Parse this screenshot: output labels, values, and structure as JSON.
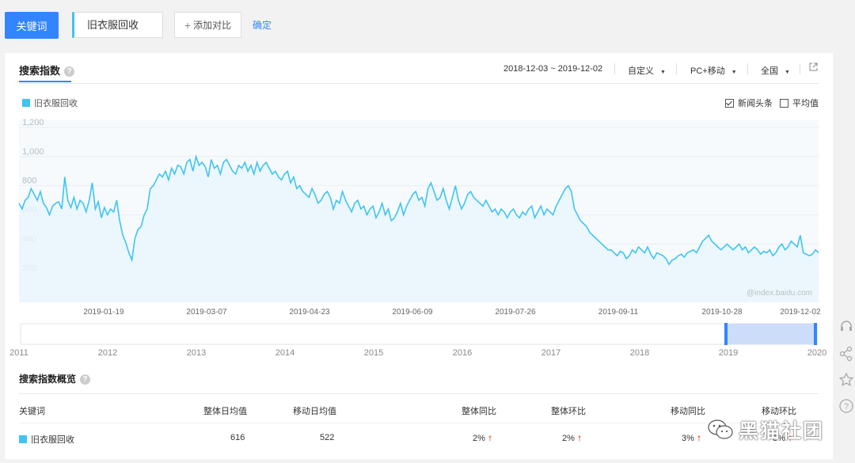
{
  "topbar": {
    "keyword_button": "关键词",
    "keyword_value": "旧衣服回收",
    "add_compare": "添加对比",
    "confirm": "确定"
  },
  "panel": {
    "tab_label": "搜索指数",
    "date_range": "2018-12-03 ~ 2019-12-02",
    "custom_select": "自定义",
    "device_select": "PC+移动",
    "region_select": "全国",
    "legend_label": "旧衣服回收",
    "checkbox_news": "新闻头条",
    "checkbox_news_checked": true,
    "checkbox_avg": "平均值",
    "checkbox_avg_checked": false,
    "watermark": "@index.baidu.com"
  },
  "chart_data": {
    "type": "area",
    "series": [
      {
        "name": "旧衣服回收",
        "color": "#3ec5f0"
      }
    ],
    "y_ticks": [
      "1,200",
      "1,000",
      "800",
      "600",
      "400",
      "200"
    ],
    "ylim": [
      0,
      1200
    ],
    "x_ticks": [
      "2019-01-19",
      "2019-03-07",
      "2019-04-23",
      "2019-06-09",
      "2019-07-26",
      "2019-09-11",
      "2019-10-28",
      "2019-12-02"
    ],
    "values": [
      680,
      640,
      700,
      720,
      780,
      740,
      700,
      760,
      680,
      650,
      600,
      660,
      680,
      690,
      640,
      860,
      700,
      650,
      720,
      640,
      700,
      680,
      620,
      700,
      820,
      640,
      690,
      580,
      650,
      600,
      640,
      620,
      700,
      560,
      460,
      410,
      340,
      290,
      440,
      500,
      520,
      600,
      640,
      780,
      800,
      840,
      880,
      860,
      900,
      840,
      920,
      880,
      940,
      930,
      880,
      960,
      980,
      900,
      1000,
      940,
      960,
      930,
      860,
      980,
      920,
      940,
      880,
      960,
      980,
      940,
      900,
      880,
      940,
      920,
      960,
      900,
      940,
      880,
      960,
      900,
      940,
      960,
      920,
      880,
      900,
      860,
      840,
      880,
      900,
      820,
      860,
      780,
      800,
      760,
      740,
      720,
      780,
      740,
      680,
      700,
      740,
      760,
      720,
      640,
      700,
      680,
      760,
      700,
      660,
      620,
      680,
      700,
      640,
      660,
      600,
      640,
      660,
      580,
      620,
      680,
      600,
      640,
      560,
      580,
      620,
      680,
      600,
      660,
      700,
      740,
      760,
      700,
      720,
      660,
      780,
      820,
      760,
      700,
      720,
      780,
      700,
      640,
      720,
      800,
      700,
      640,
      680,
      740,
      760,
      720,
      700,
      680,
      660,
      700,
      660,
      620,
      640,
      600,
      640,
      620,
      580,
      620,
      640,
      600,
      580,
      620,
      600,
      640,
      660,
      580,
      620,
      660,
      600,
      640,
      620,
      600,
      660,
      700,
      740,
      780,
      800,
      760,
      640,
      600,
      560,
      540,
      520,
      480,
      460,
      440,
      420,
      400,
      380,
      360,
      360,
      340,
      320,
      350,
      340,
      300,
      320,
      360,
      340,
      380,
      360,
      340,
      380,
      330,
      300,
      340,
      330,
      320,
      300,
      260,
      290,
      300,
      320,
      330,
      310,
      340,
      350,
      360,
      340,
      380,
      420,
      440,
      460,
      420,
      400,
      380,
      360,
      380,
      400,
      380,
      360,
      380,
      400,
      360,
      380,
      340,
      360,
      380,
      360,
      330,
      350,
      340,
      360,
      320,
      340,
      380,
      400,
      360,
      380,
      420,
      400,
      380,
      460,
      340,
      330,
      320,
      330,
      360,
      340
    ]
  },
  "range_slider": {
    "years": [
      "2011",
      "2012",
      "2013",
      "2014",
      "2015",
      "2016",
      "2017",
      "2018",
      "2019",
      "2020"
    ]
  },
  "overview": {
    "title": "搜索指数概览",
    "headers": [
      "关键词",
      "整体日均值",
      "移动日均值",
      "整体同比",
      "整体环比",
      "移动同比",
      "移动环比"
    ],
    "row": {
      "keyword": "旧衣服回收",
      "overall_daily_avg": "616",
      "mobile_daily_avg": "522",
      "overall_yoy": "2%",
      "overall_mom": "2%",
      "mobile_yoy": "3%",
      "mobile_mom": "3%"
    }
  },
  "watermark_brand": "黑猫社团",
  "colors": {
    "accent": "#3385ff",
    "series": "#3ec5f0",
    "up_arrow": "#f0643c"
  }
}
